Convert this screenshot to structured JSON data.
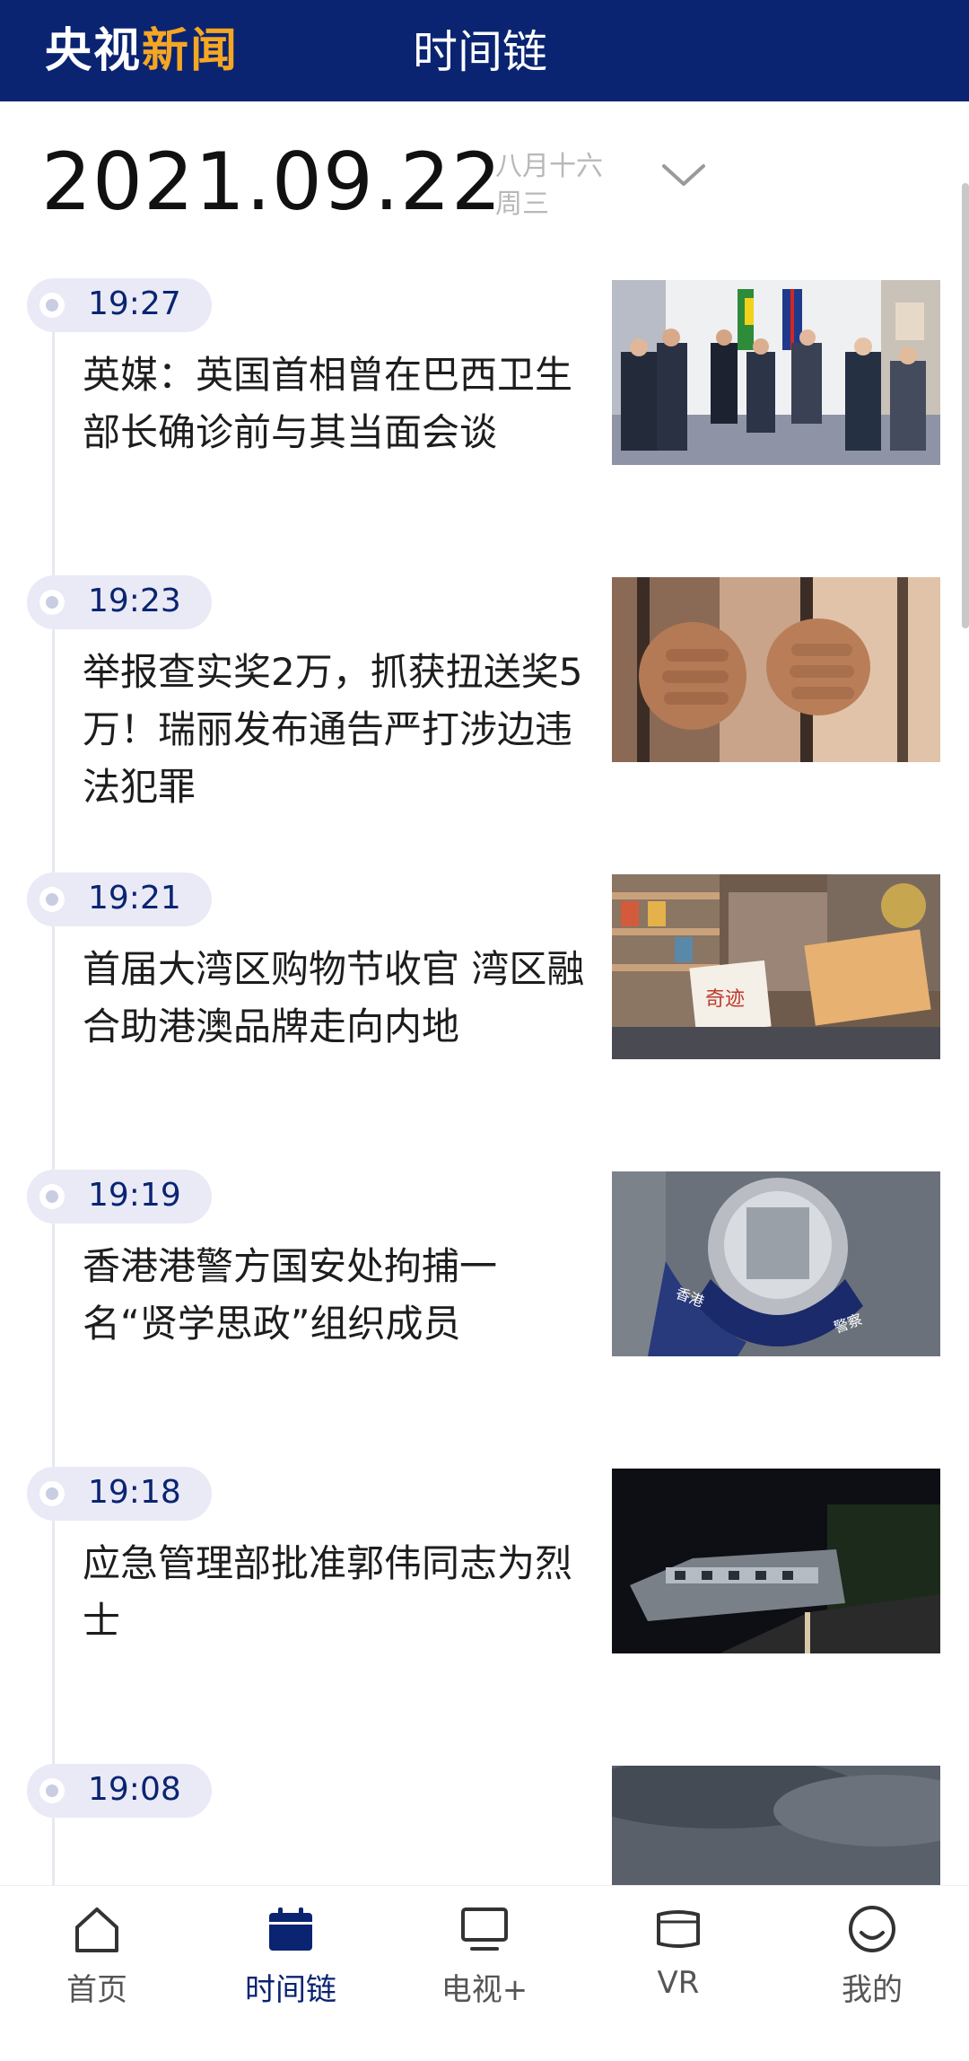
{
  "header": {
    "logo_part1": "央视",
    "logo_part2": "新闻",
    "title": "时间链"
  },
  "date": {
    "full": "2021.09.22",
    "lunar": "八月十六",
    "weekday": "周三",
    "dropdown_icon": "chevron-down-icon"
  },
  "items": [
    {
      "time": "19:27",
      "headline": "英媒：英国首相曾在巴西卫生部长确诊前与其当面会谈",
      "image": "meeting-photo"
    },
    {
      "time": "19:23",
      "headline": "举报查实奖2万，抓获扭送奖5万！瑞丽发布通告严打涉边违法犯罪",
      "image": "hands-bars-photo"
    },
    {
      "time": "19:21",
      "headline": "首届大湾区购物节收官 湾区融合助港澳品牌走向内地",
      "image": "shop-photo"
    },
    {
      "time": "19:19",
      "headline": "香港港警方国安处拘捕一名“贤学思政”组织成员",
      "image": "police-emblem-photo"
    },
    {
      "time": "19:18",
      "headline": "应急管理部批准郭伟同志为烈士",
      "image": "night-crash-photo"
    },
    {
      "time": "19:08",
      "headline": "",
      "image": "sky-photo"
    }
  ],
  "tabs": [
    {
      "label": "首页",
      "icon": "home-icon"
    },
    {
      "label": "时间链",
      "icon": "calendar-icon",
      "active": true
    },
    {
      "label": "电视+",
      "icon": "tv-icon"
    },
    {
      "label": "VR",
      "icon": "vr-icon"
    },
    {
      "label": "我的",
      "icon": "smiley-icon"
    }
  ],
  "colors": {
    "brand": "#0a2472",
    "accent": "#f5a623",
    "pill": "#e9eaf6"
  }
}
